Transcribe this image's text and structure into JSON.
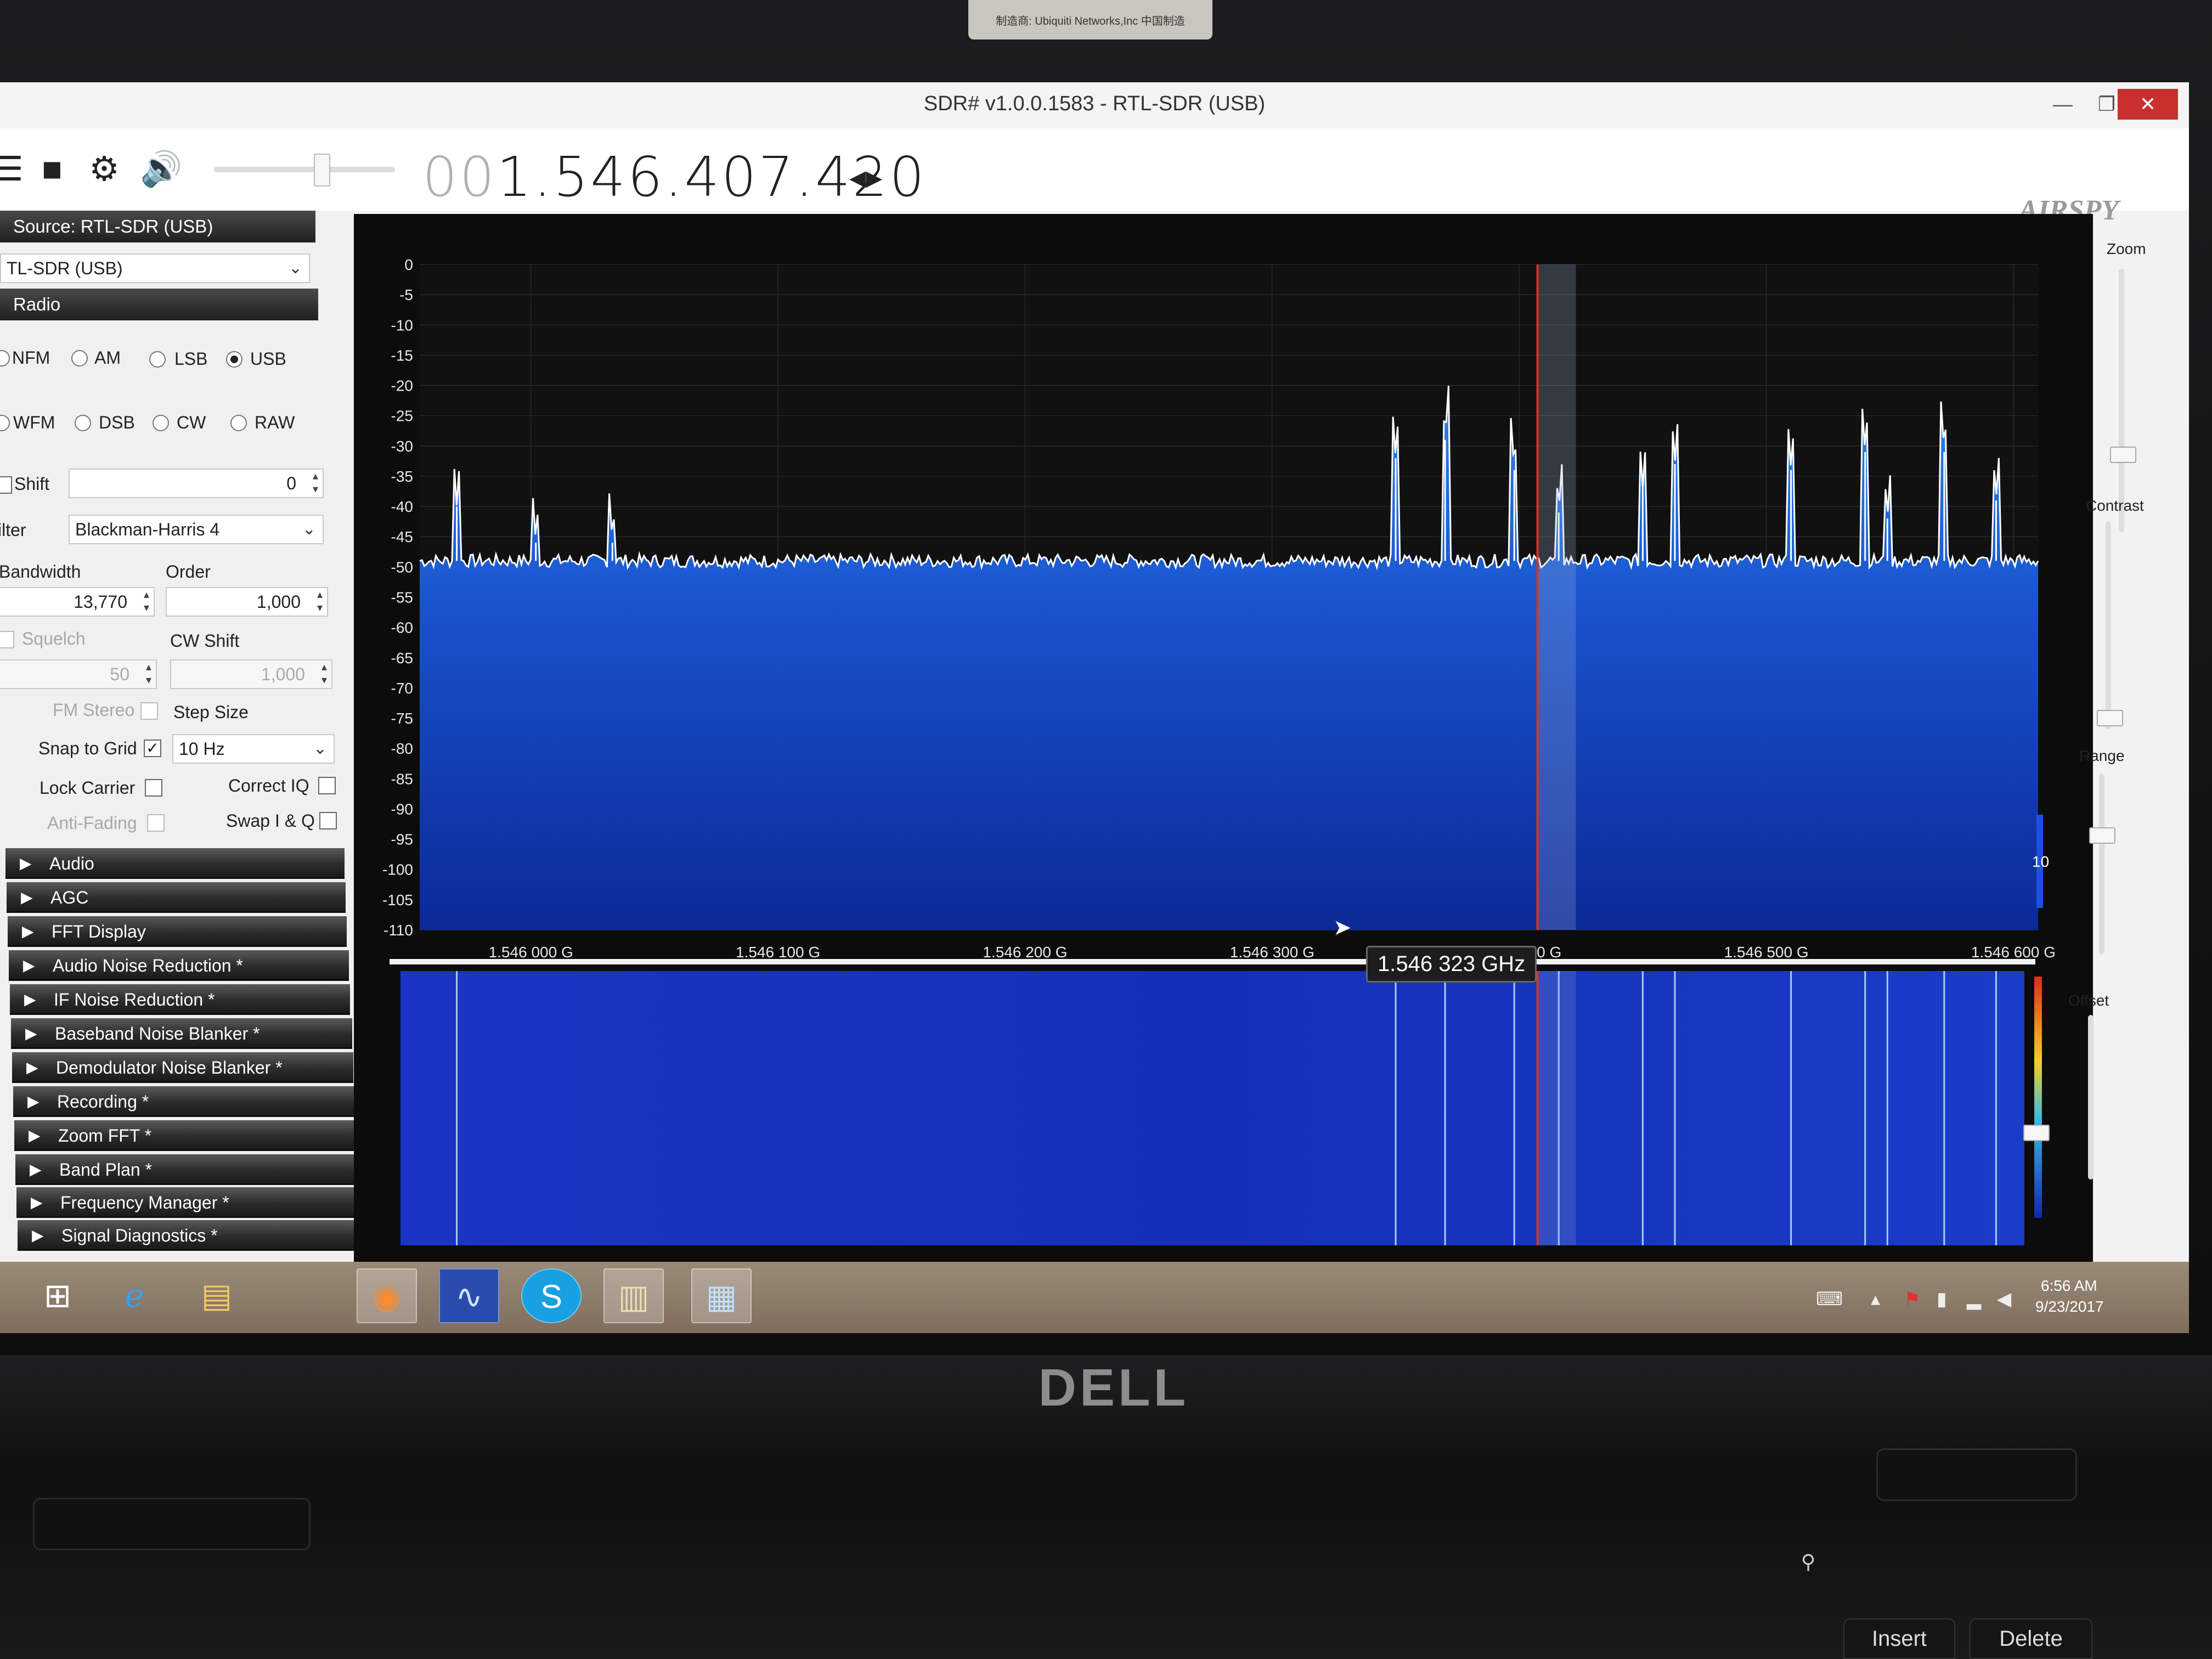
{
  "sticker": {
    "text": "制造商: Ubiquiti Networks,Inc    中国制造"
  },
  "window": {
    "title": "SDR# v1.0.0.1583 - RTL-SDR (USB)",
    "minimize": "—",
    "maximize": "❐",
    "close": "✕"
  },
  "toolbar": {
    "menu_icon": "menu-icon",
    "stop_icon": "stop-icon",
    "settings_icon": "gear-icon",
    "volume_icon": "speaker-icon",
    "frequency_dim": "00",
    "frequency_main": "1.546.407.420",
    "frequency_arrows": "◂▸",
    "logo": "AIRSPY"
  },
  "source": {
    "header": "Source: RTL-SDR (USB)",
    "device": "TL-SDR (USB)"
  },
  "radio": {
    "header": "Radio",
    "modes_row1": [
      {
        "label": "NFM",
        "checked": false
      },
      {
        "label": "AM",
        "checked": false
      },
      {
        "label": "LSB",
        "checked": false
      },
      {
        "label": "USB",
        "checked": true
      }
    ],
    "modes_row2": [
      {
        "label": "WFM",
        "checked": false
      },
      {
        "label": "DSB",
        "checked": false
      },
      {
        "label": "CW",
        "checked": false
      },
      {
        "label": "RAW",
        "checked": false
      }
    ],
    "shift_label": "Shift",
    "shift_value": "0",
    "filter_label": "ilter",
    "filter_value": "Blackman-Harris 4",
    "bandwidth_label": "Bandwidth",
    "bandwidth_value": "13,770",
    "order_label": "Order",
    "order_value": "1,000",
    "squelch_label": "Squelch",
    "squelch_value": "50",
    "cw_shift_label": "CW Shift",
    "cw_shift_value": "1,000",
    "fm_stereo_label": "FM Stereo",
    "step_size_label": "Step Size",
    "snap_label": "Snap to Grid",
    "snap_checked": "✓",
    "step_value": "10 Hz",
    "lock_carrier_label": "Lock Carrier",
    "correct_iq_label": "Correct IQ",
    "anti_fading_label": "Anti-Fading",
    "swap_iq_label": "Swap I & Q"
  },
  "panels": [
    "Audio",
    "AGC",
    "FFT Display",
    "Audio Noise Reduction *",
    "IF Noise Reduction *",
    "Baseband Noise Blanker *",
    "Demodulator Noise Blanker *",
    "Recording *",
    "Zoom FFT *",
    "Band Plan *",
    "Frequency Manager *",
    "Signal Diagnostics *"
  ],
  "side_controls": {
    "zoom": "Zoom",
    "contrast": "Contrast",
    "range": "Range",
    "offset": "Offset",
    "range_value": "10"
  },
  "tooltip": "1.546 323 GHz",
  "taskbar": {
    "time": "6:56 AM",
    "date": "9/23/2017"
  },
  "laptop": {
    "brand": "DELL",
    "keys": [
      "Insert",
      "Delete"
    ]
  },
  "colors": {
    "spectrum_fill": "#1a57d8",
    "trace": "#ffffff",
    "tuned_line": "#e0301e",
    "waterfall": "#1530b8",
    "accent": "#c8302e"
  },
  "chart_data": {
    "type": "line",
    "title": "",
    "xlabel": "",
    "ylabel": "",
    "ylim": [
      -110,
      0
    ],
    "xlim": [
      1.545955,
      1.54661
    ],
    "y_ticks": [
      "0",
      "-5",
      "-10",
      "-15",
      "-20",
      "-25",
      "-30",
      "-35",
      "-40",
      "-45",
      "-50",
      "-55",
      "-60",
      "-65",
      "-70",
      "-75",
      "-80",
      "-85",
      "-90",
      "-95",
      "-100",
      "-105",
      "-110"
    ],
    "x_ticks": [
      {
        "value": 1.546,
        "label": "1.546 000 G"
      },
      {
        "value": 1.5461,
        "label": "1.546 100 G"
      },
      {
        "value": 1.5462,
        "label": "1.546 200 G"
      },
      {
        "value": 1.5463,
        "label": "1.546 300 G"
      },
      {
        "value": 1.5464,
        "label": "1.546 400 G"
      },
      {
        "value": 1.5465,
        "label": "1.546 500 G"
      },
      {
        "value": 1.5466,
        "label": "1.546 600 G"
      }
    ],
    "noise_floor_db": -49,
    "peaks": [
      {
        "x": 1.54597,
        "y": -40
      },
      {
        "x": 1.546002,
        "y": -46
      },
      {
        "x": 1.546033,
        "y": -46
      },
      {
        "x": 1.54635,
        "y": -32
      },
      {
        "x": 1.54637,
        "y": -29
      },
      {
        "x": 1.546398,
        "y": -34
      },
      {
        "x": 1.546416,
        "y": -41
      },
      {
        "x": 1.54645,
        "y": -37
      },
      {
        "x": 1.546463,
        "y": -33
      },
      {
        "x": 1.54651,
        "y": -34
      },
      {
        "x": 1.54654,
        "y": -31
      },
      {
        "x": 1.546549,
        "y": -42
      },
      {
        "x": 1.546572,
        "y": -31
      },
      {
        "x": 1.546593,
        "y": -39
      }
    ],
    "tuned_frequency": 1.5464074,
    "grid": true
  }
}
